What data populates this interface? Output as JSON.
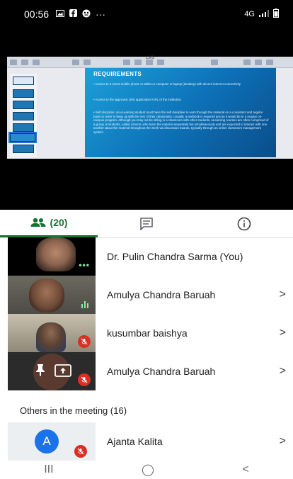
{
  "status_bar": {
    "time": "00:56",
    "more": "···",
    "network_label": "4G",
    "icons": [
      "gallery-icon",
      "facebook-icon",
      "app-icon",
      "signal-icon",
      "battery-icon"
    ]
  },
  "presentation": {
    "window_title": "LMS",
    "slide_title": "REQUIREMENTS",
    "bullets": [
      "• Access to a smart mobile phone or tablet or computer or laptop (desktop) with decent internet connectivity",
      "• Access to the approved LMS application/ URL of the institution",
      "• Self discipline: an eLearning student must have the self discipline to work through the material on a consistent and regular basis in order to keep up with the rest of their classmates. Usually, a textbook is required just as it would be in a regular on-campus program. Although you may not be sitting in a classroom with other students, eLearning courses are often comprised of a group of students, called cohorts, who learn the material separately but simultaneously and are expected to interact with one another about the material throughout the week via discussion boards, typically through an online classroom management system"
    ]
  },
  "tabs": {
    "people_count": "(20)",
    "active": "people"
  },
  "participants": [
    {
      "name": "Dr. Pulin Chandra Sarma (You)",
      "state": "speaking",
      "has_chevron": false
    },
    {
      "name": "Amulya Chandra Baruah",
      "state": "speaking",
      "has_chevron": true
    },
    {
      "name": "kusumbar baishya",
      "state": "muted",
      "has_chevron": true
    },
    {
      "name": "Amulya Chandra Baruah",
      "state": "presenting-muted",
      "has_chevron": true
    }
  ],
  "others": {
    "title": "Others in the meeting (16)",
    "items": [
      {
        "initial": "A",
        "name": "Ajanta Kalita",
        "state": "muted",
        "avatar_color": "#1a73e8"
      }
    ]
  },
  "colors": {
    "accent_green": "#137333",
    "mute_red": "#d93025",
    "speaking_green": "#7cf39a"
  },
  "nav": {
    "recent": "III",
    "home": "◯",
    "back": "<"
  }
}
